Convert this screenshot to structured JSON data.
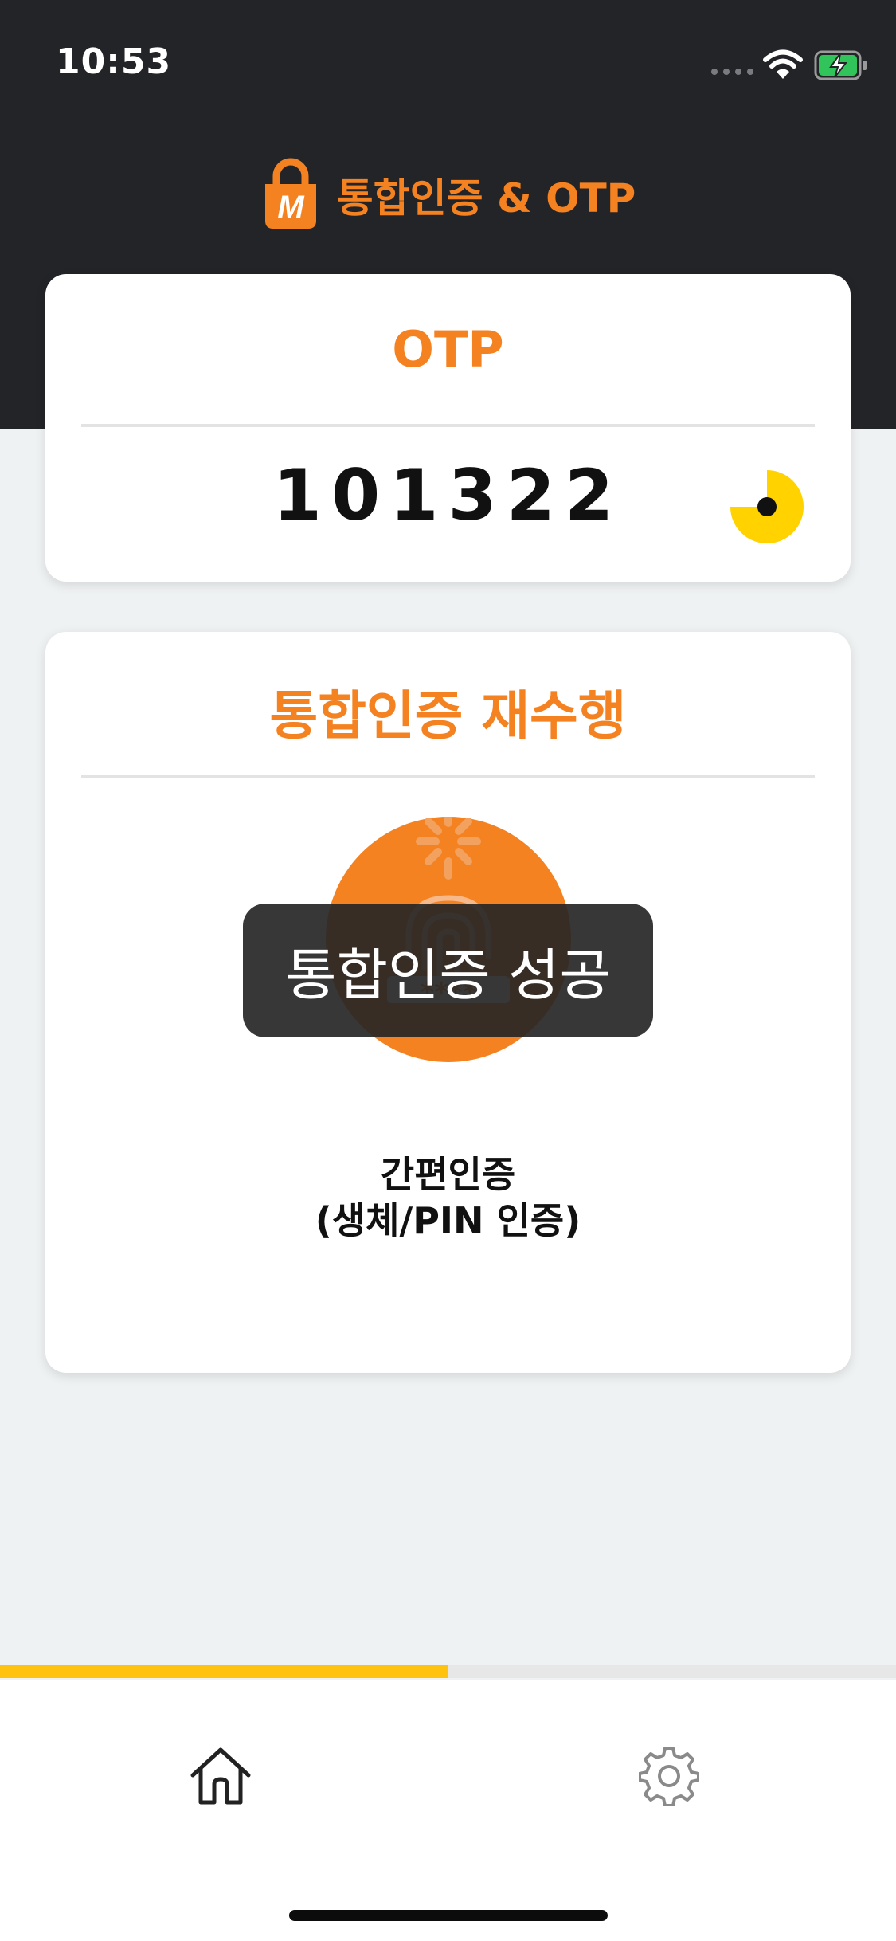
{
  "status_bar": {
    "time": "10:53",
    "icons": [
      "signal-icon",
      "wifi-icon",
      "battery-charging-icon"
    ]
  },
  "header": {
    "logo_letter": "M",
    "title": "통합인증 & OTP"
  },
  "otp_card": {
    "title": "OTP",
    "code": "101322",
    "timer_remaining_fraction": 0.75
  },
  "auth_card": {
    "title": "통합인증 재수행",
    "pin_mask": "****",
    "label_line1": "간편인증",
    "label_line2": "(생체/PIN 인증)"
  },
  "toast": {
    "message": "통합인증 성공"
  },
  "progress": {
    "value_fraction": 0.5
  },
  "tab_bar": {
    "items": [
      "home-icon",
      "gear-icon"
    ]
  },
  "colors": {
    "accent": "#f58220",
    "dark_header": "#232428",
    "progress": "#ffc20e",
    "timer": "#ffd200",
    "background": "#eff2f3"
  }
}
